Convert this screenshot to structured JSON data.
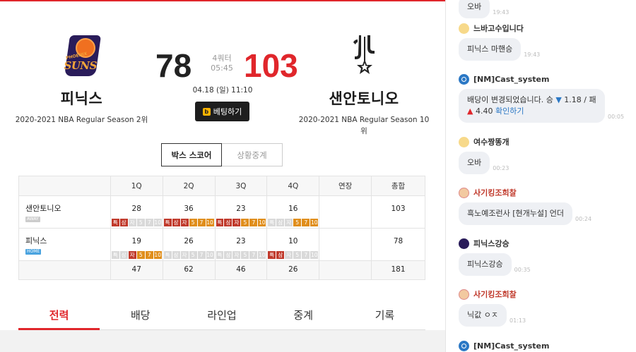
{
  "game": {
    "home": {
      "name": "피닉스",
      "season": "2020-2021 NBA Regular Season 2위",
      "score": "78",
      "logo_text": "SUNS",
      "logo_small": "PHOENIX"
    },
    "away": {
      "name": "샌안토니오",
      "season": "2020-2021 NBA Regular Season 10위",
      "score": "103"
    },
    "quarter": "4쿼터",
    "clock": "05:45",
    "datetime": "04.18 (일) 11:10",
    "bet_button": {
      "icon": "b",
      "label": "베팅하기"
    }
  },
  "view_tabs": [
    {
      "label": "박스 스코어",
      "active": true
    },
    {
      "label": "상황중계",
      "active": false
    }
  ],
  "boxscore": {
    "headers": [
      "1Q",
      "2Q",
      "3Q",
      "4Q",
      "연장",
      "총합"
    ],
    "rows": [
      {
        "team": "샌안토니오",
        "badge": "AWAY",
        "scores": [
          "28",
          "36",
          "23",
          "16",
          "",
          "103"
        ],
        "flags": [
          [
            {
              "t": "특",
              "c": "red"
            },
            {
              "t": "삼",
              "c": "red"
            },
            {
              "t": "자",
              "c": "gray"
            },
            {
              "t": "5",
              "c": "gray"
            },
            {
              "t": "7",
              "c": "gray"
            },
            {
              "t": "10",
              "c": "gray"
            }
          ],
          [
            {
              "t": "특",
              "c": "red"
            },
            {
              "t": "삼",
              "c": "red"
            },
            {
              "t": "자",
              "c": "red"
            },
            {
              "t": "5",
              "c": "org"
            },
            {
              "t": "7",
              "c": "org"
            },
            {
              "t": "10",
              "c": "org"
            }
          ],
          [
            {
              "t": "특",
              "c": "red"
            },
            {
              "t": "삼",
              "c": "red"
            },
            {
              "t": "자",
              "c": "red"
            },
            {
              "t": "5",
              "c": "org"
            },
            {
              "t": "7",
              "c": "org"
            },
            {
              "t": "10",
              "c": "org"
            }
          ],
          [
            {
              "t": "특",
              "c": "gray"
            },
            {
              "t": "삼",
              "c": "gray"
            },
            {
              "t": "자",
              "c": "gray"
            },
            {
              "t": "5",
              "c": "org"
            },
            {
              "t": "7",
              "c": "org"
            },
            {
              "t": "10",
              "c": "org"
            }
          ]
        ]
      },
      {
        "team": "피닉스",
        "badge": "HOME",
        "scores": [
          "19",
          "26",
          "23",
          "10",
          "",
          "78"
        ],
        "flags": [
          [
            {
              "t": "특",
              "c": "gray"
            },
            {
              "t": "삼",
              "c": "gray"
            },
            {
              "t": "자",
              "c": "red"
            },
            {
              "t": "5",
              "c": "org"
            },
            {
              "t": "7",
              "c": "org"
            },
            {
              "t": "10",
              "c": "org"
            }
          ],
          [
            {
              "t": "특",
              "c": "gray"
            },
            {
              "t": "삼",
              "c": "gray"
            },
            {
              "t": "자",
              "c": "gray"
            },
            {
              "t": "5",
              "c": "gray"
            },
            {
              "t": "7",
              "c": "gray"
            },
            {
              "t": "10",
              "c": "gray"
            }
          ],
          [
            {
              "t": "특",
              "c": "gray"
            },
            {
              "t": "삼",
              "c": "gray"
            },
            {
              "t": "자",
              "c": "gray"
            },
            {
              "t": "5",
              "c": "gray"
            },
            {
              "t": "7",
              "c": "gray"
            },
            {
              "t": "10",
              "c": "gray"
            }
          ],
          [
            {
              "t": "특",
              "c": "red"
            },
            {
              "t": "삼",
              "c": "red"
            },
            {
              "t": "자",
              "c": "gray"
            },
            {
              "t": "5",
              "c": "gray"
            },
            {
              "t": "7",
              "c": "gray"
            },
            {
              "t": "10",
              "c": "gray"
            }
          ]
        ]
      }
    ],
    "totals": [
      "47",
      "62",
      "46",
      "26",
      "",
      "181"
    ]
  },
  "bottom_tabs": [
    {
      "label": "전력",
      "active": true
    },
    {
      "label": "배당",
      "active": false
    },
    {
      "label": "라인업",
      "active": false
    },
    {
      "label": "중계",
      "active": false
    },
    {
      "label": "기록",
      "active": false
    }
  ],
  "chat": {
    "top_fragment": {
      "text": "오바",
      "time": "19:43"
    },
    "messages": [
      {
        "user": "느바고수입니다",
        "avatar": "yellow",
        "red": false,
        "text": "피닉스 마핸승",
        "time": "19:43"
      },
      {
        "user": "[NM]Cast_system",
        "avatar": "blue",
        "red": false,
        "text_parts": [
          "배당이 변경되었습니다. 승 ",
          "▼",
          " 1.18 / 패 ",
          "▲",
          " 4.40 ",
          "확인하기"
        ],
        "time": "00:05"
      },
      {
        "user": "여수짱똥개",
        "avatar": "yellow",
        "red": false,
        "text": "오바",
        "time": "00:23"
      },
      {
        "user": "사기킹조희찰",
        "avatar": "face",
        "red": true,
        "text": "흑노예조런사 [현개누설] 언더",
        "time": "00:24"
      },
      {
        "user": "피닉스강승",
        "avatar": "suns",
        "red": false,
        "text": "피닉스강승",
        "time": "00:35"
      },
      {
        "user": "사기킹조희찰",
        "avatar": "face",
        "red": true,
        "text": "닉값 ㅇㅈ",
        "time": "01:13"
      },
      {
        "user": "[NM]Cast_system",
        "avatar": "blue",
        "red": false
      }
    ]
  },
  "colors": {
    "accent": "#e0262b",
    "dark": "#1e1e1e",
    "link": "#2b78c5",
    "flag_red": "#c0392b",
    "flag_orange": "#e08e1b"
  }
}
